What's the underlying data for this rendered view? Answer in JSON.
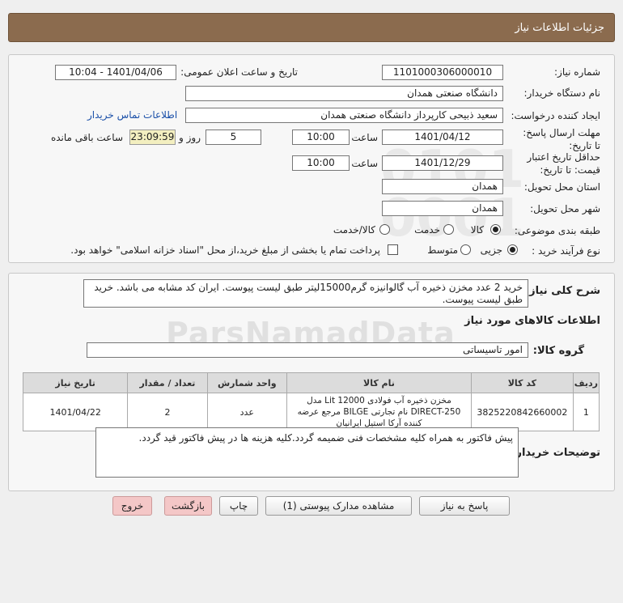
{
  "header": {
    "title": "جزئیات اطلاعات نیاز"
  },
  "fields": {
    "need_number_label": "شماره نیاز:",
    "need_number": "1101000306000010",
    "announce_label": "تاریخ و ساعت اعلان عمومی:",
    "announce_value": "1401/04/06 - 10:04",
    "buyer_org_label": "نام دستگاه خریدار:",
    "buyer_org": "دانشگاه صنعتی همدان",
    "requester_label": "ایجاد کننده درخواست:",
    "requester": "سعید ذبیحی کارپرداز دانشگاه صنعتی همدان",
    "contact_link": "اطلاعات تماس خریدار",
    "reply_deadline_label": "مهلت ارسال پاسخ: تا تاریخ:",
    "reply_date": "1401/04/12",
    "time_label": "ساعت",
    "reply_time": "10:00",
    "days_value": "5",
    "days_label": "روز و",
    "remaining_time": "23:09:59",
    "remaining_label": "ساعت باقی مانده",
    "validity_label": "حداقل تاریخ اعتبار قیمت: تا تاریخ:",
    "validity_date": "1401/12/29",
    "validity_time": "10:00",
    "province_label": "استان محل تحویل:",
    "province": "همدان",
    "city_label": "شهر محل تحویل:",
    "city": "همدان",
    "category_label": "طبقه بندی موضوعی:",
    "category_options": [
      "کالا",
      "خدمت",
      "کالا/خدمت"
    ],
    "process_label": "نوع فرآیند خرید :",
    "process_options": [
      "جزیی",
      "متوسط"
    ],
    "payment_note": "پرداخت تمام یا بخشی از مبلغ خرید،از محل \"اسناد خزانه اسلامی\" خواهد بود."
  },
  "description": {
    "label": "شرح کلی نیاز:",
    "text": "خرید 2 عدد مخزن ذخیره آب گالوانیزه گرم15000لیتر طبق لیست پیوست. ایران کد مشابه می باشد. خرید طبق لیست پیوست."
  },
  "goods": {
    "section_title": "اطلاعات کالاهای مورد نیاز",
    "group_label": "گروه کالا:",
    "group_value": "امور تاسیساتی",
    "columns": [
      "ردیف",
      "کد کالا",
      "نام کالا",
      "واحد شمارش",
      "تعداد / مقدار",
      "تاریخ نیاز"
    ],
    "rows": [
      {
        "row": "1",
        "code": "3825220842660002",
        "name": "مخزن ذخیره آب فولادی Lit 12000 مدل DIRECT-250 نام تجارتی BILGE مرجع عرضه کننده آرکا استیل ایرانیان",
        "unit": "عدد",
        "qty": "2",
        "date": "1401/04/22"
      }
    ]
  },
  "notes": {
    "label": "توضیحات خریدار:",
    "text": "پیش فاکتور به همراه کلیه مشخصات فنی ضمیمه گردد.کلیه هزینه ها در پیش فاکتور قید گردد."
  },
  "buttons": {
    "reply": "پاسخ به نیاز",
    "view_docs": "مشاهده مدارک پیوستی (1)",
    "print": "چاپ",
    "back": "بازگشت",
    "exit": "خروج"
  }
}
